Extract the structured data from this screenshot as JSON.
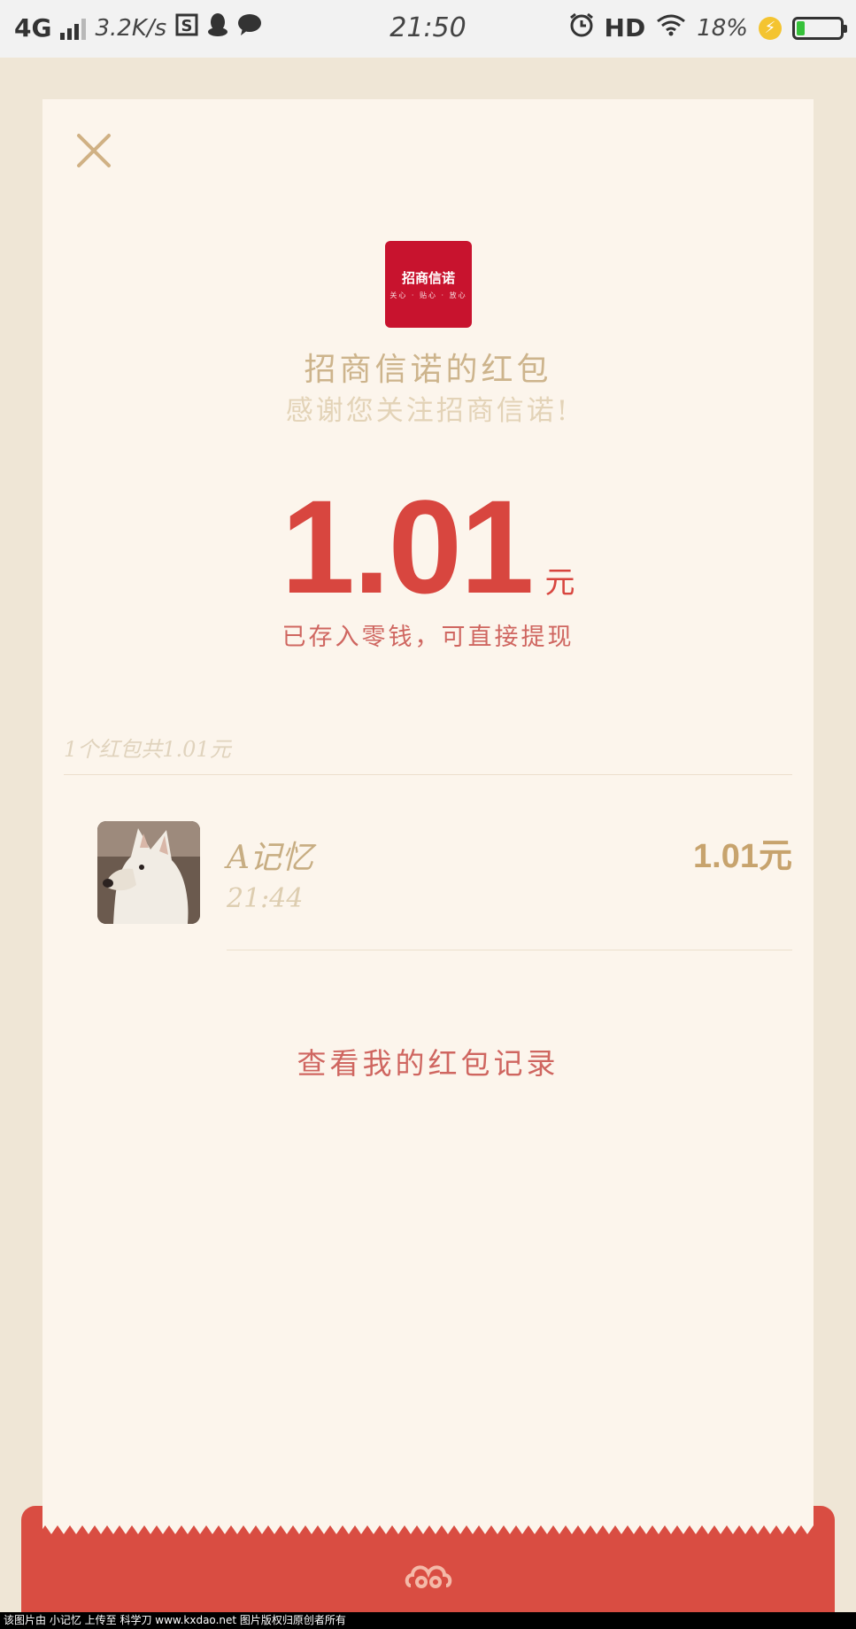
{
  "status_bar": {
    "network": "4G",
    "speed": "3.2K/s",
    "time": "21:50",
    "hd": "HD",
    "battery_text": "18%",
    "battery_level": 0.18
  },
  "envelope": {
    "logo_text": "招商信诺",
    "logo_subtext": "关心 · 贴心 · 放心",
    "sender_title": "招商信诺的红包",
    "greeting": "感谢您关注招商信诺!",
    "amount": "1.01",
    "unit": "元",
    "saved_note": "已存入零钱，可直接提现",
    "summary": "1个红包共1.01元",
    "records": [
      {
        "name": "A记忆",
        "time": "21:44",
        "amount": "1.01元"
      }
    ],
    "records_link": "查看我的红包记录"
  },
  "colors": {
    "accent_red": "#d8463f",
    "gold": "#c7a36d",
    "card_bg": "#fcf5ec"
  },
  "watermark": "该图片由 小记忆 上传至 科学刀 www.kxdao.net 图片版权归原创者所有"
}
